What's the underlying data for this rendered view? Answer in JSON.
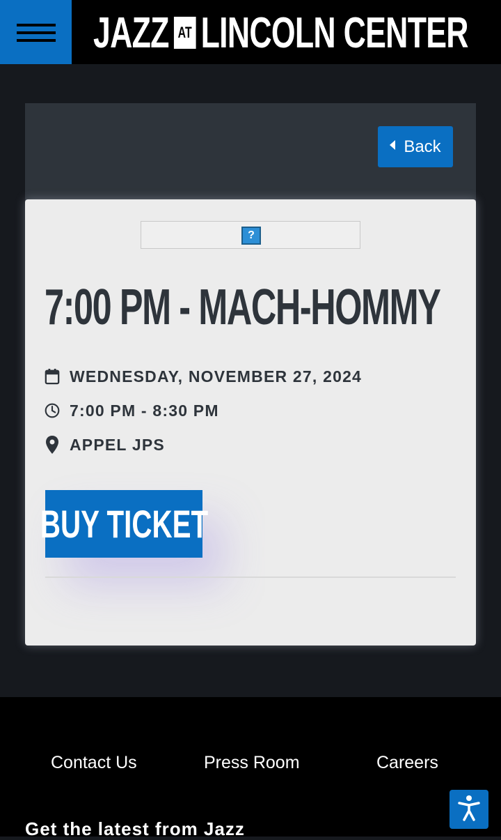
{
  "header": {
    "logo_left": "JAZZ",
    "logo_at": "AT",
    "logo_right": "LINCOLN CENTER",
    "menu_icon": "hamburger-icon"
  },
  "hero": {
    "back_label": "Back",
    "back_icon": "caret-left-icon"
  },
  "event": {
    "image_placeholder": "?",
    "title": "7:00 PM - MACH-HOMMY",
    "date": "WEDNESDAY, NOVEMBER 27, 2024",
    "time": "7:00 PM - 8:30 PM",
    "venue": "APPEL JPS",
    "buy_label": "BUY TICKET",
    "icons": {
      "date": "calendar-icon",
      "time": "clock-icon",
      "venue": "location-pin-icon"
    }
  },
  "footer": {
    "links": [
      "Contact Us",
      "Press Room",
      "Careers"
    ],
    "newsletter_heading": "Get the latest from Jazz",
    "accessibility_icon": "accessibility-icon"
  },
  "colors": {
    "brand_blue": "#0a6fc2",
    "dark_bg": "#16191e",
    "hero_bg": "#2e343b",
    "card_bg": "#ececec"
  }
}
